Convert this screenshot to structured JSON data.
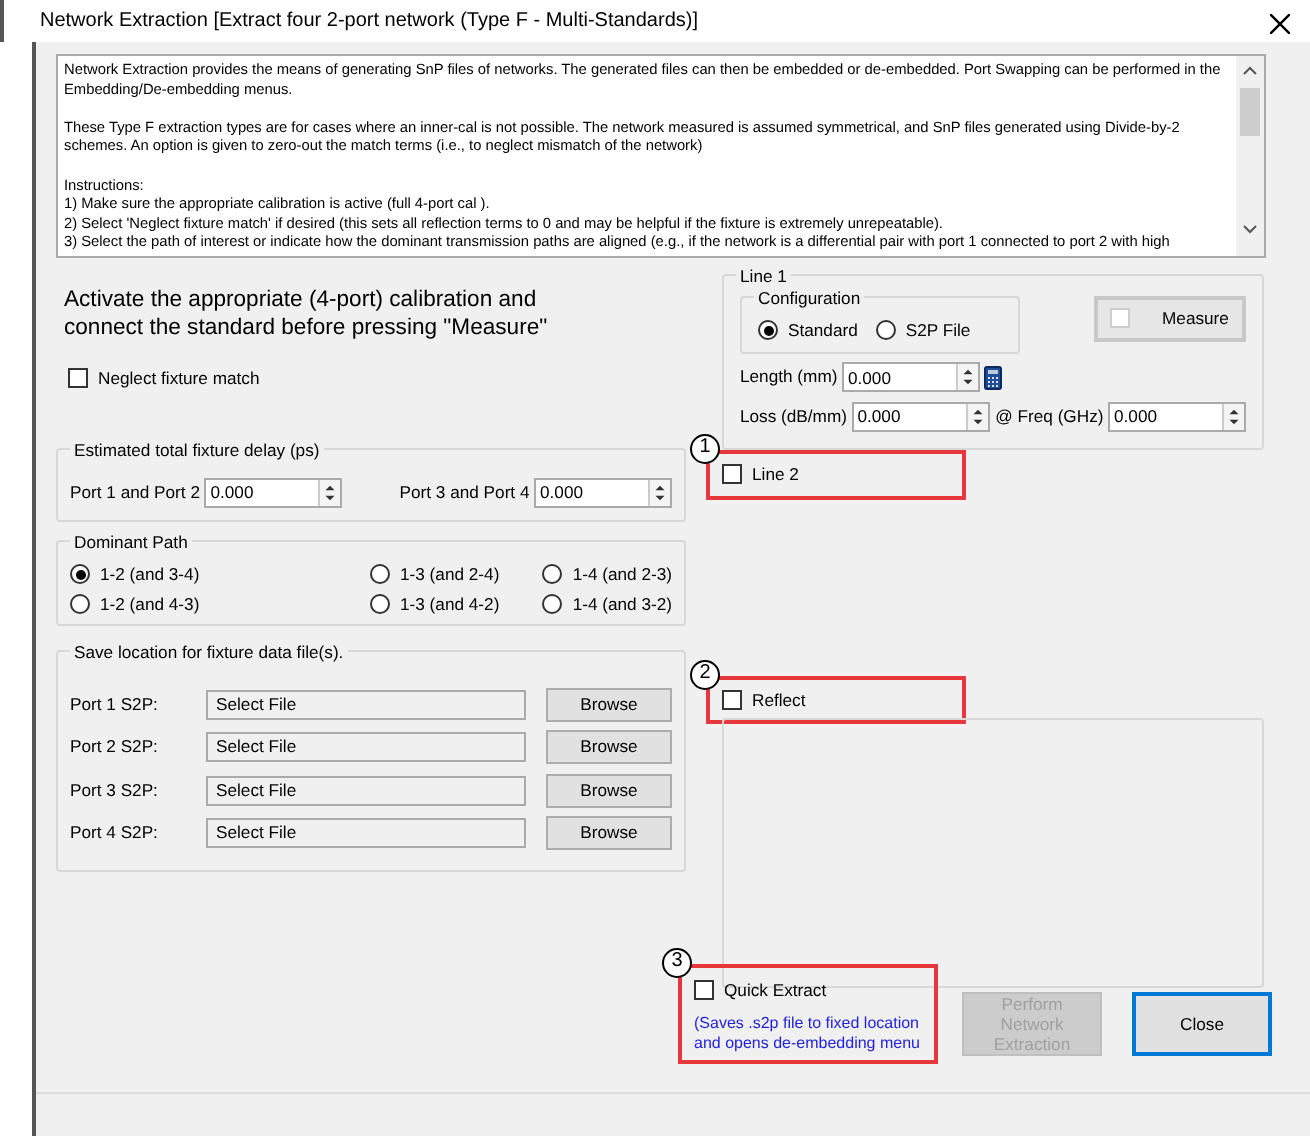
{
  "window": {
    "title": "Network Extraction [Extract four 2-port network (Type F - Multi-Standards)]"
  },
  "description": [
    [
      "Network Extraction provides the means of generating SnP files of networks. The generated files can then be embedded or de-embedded. Port Swapping can be performed in the Embedding/De-embedding menus."
    ],
    [
      "These Type F extraction types are for cases where an inner-cal is not possible. The network measured is assumed symmetrical, and SnP files generated using Divide-by-2 schemes. An option is given to zero-out the match terms (i.e., to neglect mismatch of the network)"
    ],
    [
      "Instructions:",
      "1) Make sure the appropriate calibration is active (full 4-port cal ).",
      "2) Select 'Neglect fixture match' if desired (this sets all reflection terms to 0 and may be helpful if the fixture is extremely unrepeatable).",
      "3) Select the path of interest or indicate how the dominant transmission paths are aligned (e.g., if the network is a differential pair with port 1 connected to port 2 with high"
    ]
  ],
  "instruction_heading": "Activate the appropriate (4-port) calibration and connect the standard before pressing \"Measure\"",
  "neglect_fixture_match": {
    "label": "Neglect fixture match",
    "checked": false
  },
  "fixture_delay": {
    "title": "Estimated total fixture delay (ps)",
    "fields": [
      {
        "label": "Port 1 and Port 2",
        "value": "0.000"
      },
      {
        "label": "Port 3 and Port 4",
        "value": "0.000"
      }
    ]
  },
  "dominant_path": {
    "title": "Dominant Path",
    "options": [
      {
        "label": "1-2 (and 3-4)",
        "selected": true
      },
      {
        "label": "1-3 (and 2-4)",
        "selected": false
      },
      {
        "label": "1-4 (and 2-3)",
        "selected": false
      },
      {
        "label": "1-2 (and 4-3)",
        "selected": false
      },
      {
        "label": "1-3 (and 4-2)",
        "selected": false
      },
      {
        "label": "1-4 (and 3-2)",
        "selected": false
      }
    ]
  },
  "save_location": {
    "title": "Save location for fixture data file(s).",
    "rows": [
      {
        "label": "Port 1 S2P:",
        "value": "Select File",
        "button": "Browse"
      },
      {
        "label": "Port 2 S2P:",
        "value": "Select File",
        "button": "Browse"
      },
      {
        "label": "Port 3 S2P:",
        "value": "Select File",
        "button": "Browse"
      },
      {
        "label": "Port 4 S2P:",
        "value": "Select File",
        "button": "Browse"
      }
    ]
  },
  "line1": {
    "title": "Line 1",
    "configuration": {
      "title": "Configuration",
      "options": [
        {
          "label": "Standard",
          "selected": true
        },
        {
          "label": "S2P File",
          "selected": false
        }
      ]
    },
    "measure": {
      "label": "Measure",
      "checked": false
    },
    "length": {
      "label": "Length (mm)",
      "value": "0.000"
    },
    "loss": {
      "label": "Loss (dB/mm)",
      "value": "0.000"
    },
    "freq": {
      "label": "@ Freq (GHz)",
      "value": "0.000"
    }
  },
  "line2": {
    "label": "Line 2",
    "checked": false,
    "callout": "1"
  },
  "reflect": {
    "label": "Reflect",
    "checked": false,
    "callout": "2"
  },
  "quick_extract": {
    "label": "Quick Extract",
    "checked": false,
    "note": [
      "(Saves .s2p file to fixed location",
      "and opens de-embedding menu"
    ],
    "callout": "3"
  },
  "buttons": [
    {
      "label": "Perform Network Extraction",
      "disabled": true,
      "default": false
    },
    {
      "label": "Close",
      "disabled": false,
      "default": true
    }
  ]
}
